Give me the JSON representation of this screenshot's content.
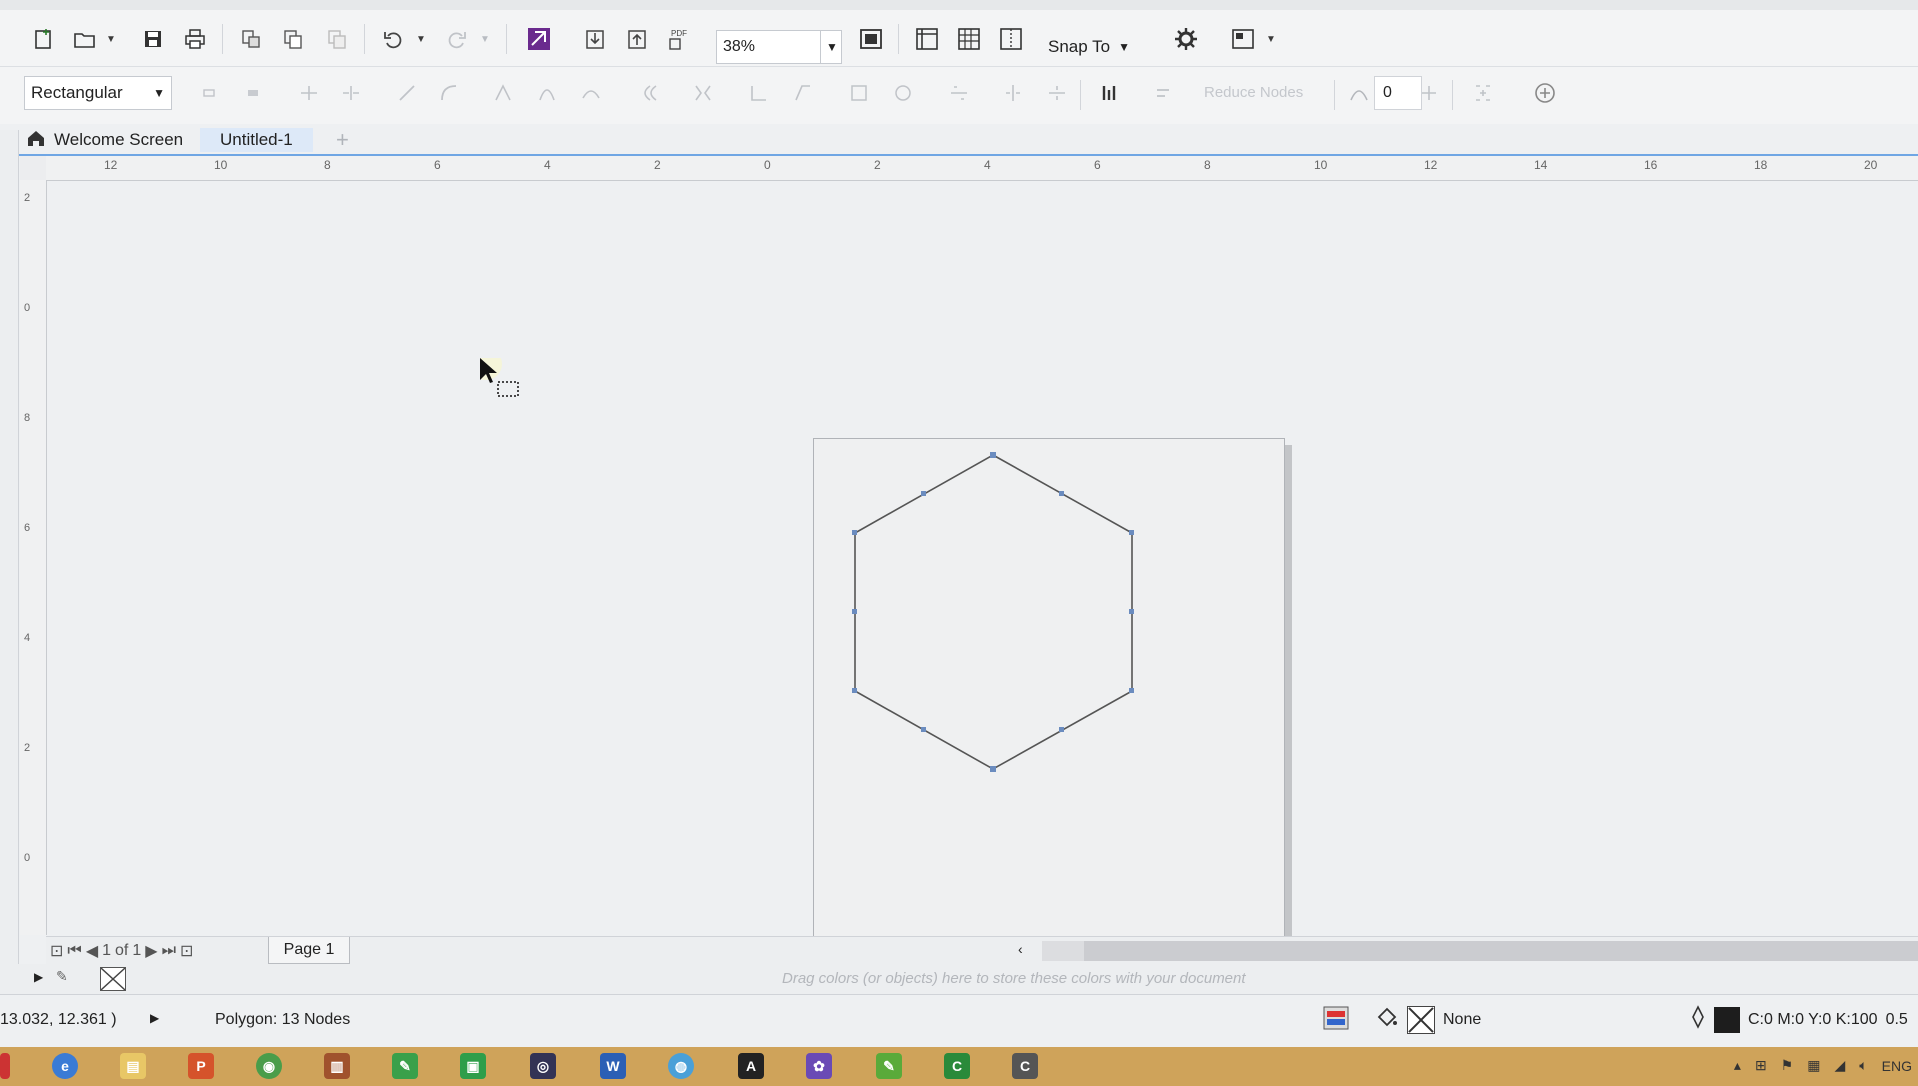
{
  "toolbar": {
    "zoom_value": "38%",
    "snap_label": "Snap To"
  },
  "property_bar": {
    "shape_type": "Rectangular",
    "reduce_nodes_label": "Reduce Nodes",
    "number_value": "0"
  },
  "tabs": [
    {
      "label": "Welcome Screen"
    },
    {
      "label": "Untitled-1"
    }
  ],
  "ruler_h_labels": [
    "12",
    "10",
    "8",
    "6",
    "4",
    "2",
    "0",
    "2",
    "4",
    "6",
    "8",
    "10",
    "12",
    "14",
    "16",
    "18",
    "20"
  ],
  "ruler_v_labels": [
    "2",
    "0",
    "8",
    "6",
    "4",
    "2",
    "0"
  ],
  "page_nav": {
    "current": "1",
    "of_text": "of",
    "total": "1",
    "page_tab": "Page 1"
  },
  "palette_hint": "Drag colors (or objects) here to store these colors with your document",
  "status": {
    "coordinates": "13.032, 12.361 )",
    "object_info": "Polygon: 13 Nodes",
    "fill_label": "None",
    "outline_color": "C:0 M:0 Y:0 K:100",
    "outline_width": "0.5"
  },
  "tray": {
    "language": "ENG"
  },
  "colors": {
    "accent": "#6fa6e4",
    "taskbar": "#cfa35a",
    "polygon_stroke": "#555555"
  }
}
